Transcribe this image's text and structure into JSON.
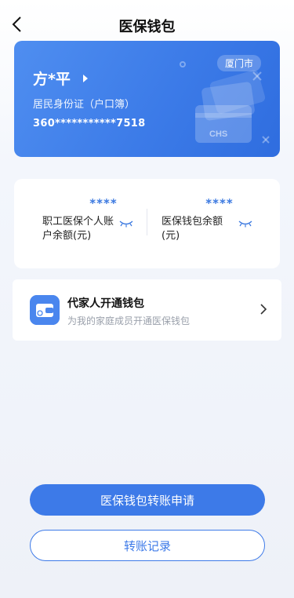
{
  "header": {
    "title": "医保钱包",
    "back_icon": "chevron-left-icon"
  },
  "card": {
    "city": "厦门市",
    "holder_name": "方*平",
    "id_type": "居民身份证（户口簿）",
    "id_number": "360***********7518",
    "gradient_colors": [
      "#4f8ef0",
      "#2f6ddf"
    ],
    "deco_icon": "chs-card-icon"
  },
  "balances": {
    "employee": {
      "masked_value": "****",
      "label": "职工医保个人账户余额(元)",
      "toggle_icon": "eye-closed-icon"
    },
    "wallet": {
      "masked_value": "****",
      "label": "医保钱包余额(元)",
      "toggle_icon": "eye-closed-icon"
    }
  },
  "family_wallet": {
    "title": "代家人开通钱包",
    "subtitle": "为我的家庭成员开通医保钱包",
    "icon": "wallet-icon",
    "arrow_icon": "chevron-right-icon"
  },
  "actions": {
    "transfer_apply": "医保钱包转账申请",
    "transfer_records": "转账记录"
  },
  "colors": {
    "accent": "#3d7ae8",
    "muted_text": "#9aa0ab"
  }
}
